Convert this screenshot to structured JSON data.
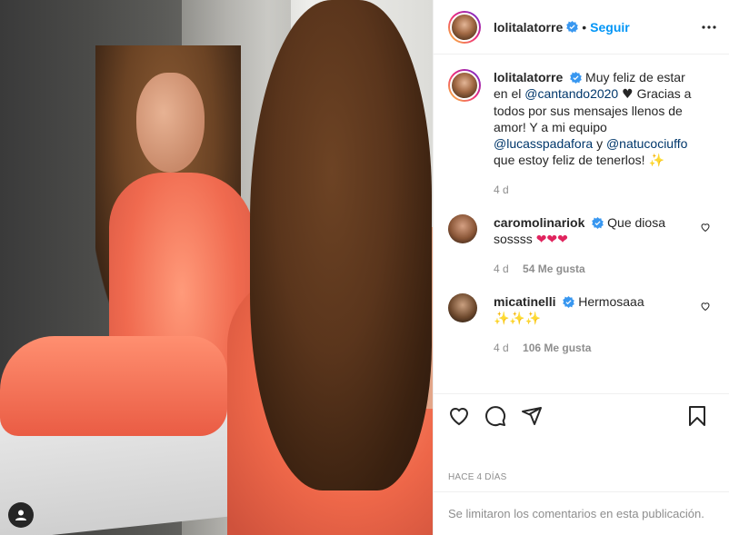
{
  "post": {
    "username": "lolitalatorre",
    "follow_label": "Seguir",
    "caption_parts": {
      "text1": "Muy feliz de estar en el",
      "mention1": "@cantando2020",
      "text2": "Gracias a todos por sus mensajes llenos de amor! Y a mi equipo",
      "mention2": "@lucasspadafora",
      "text3": "y",
      "mention3": "@natucociuffo",
      "text4": "que estoy feliz de tenerlos!"
    },
    "caption_time": "4 d",
    "time_ago": "HACE 4 DÍAS",
    "comments_limited": "Se limitaron los comentarios en esta publicación."
  },
  "comments": [
    {
      "user": "caromolinariok",
      "text": "Que diosa sossss",
      "time": "4 d",
      "likes": "54 Me gusta"
    },
    {
      "user": "micatinelli",
      "text": "Hermosaaa",
      "time": "4 d",
      "likes": "106 Me gusta"
    }
  ],
  "icons": {
    "verified": "verified-badge-icon",
    "more": "more-options-icon",
    "like": "heart-icon",
    "comment": "comment-icon",
    "share": "share-icon",
    "save": "bookmark-icon",
    "user_tag": "user-tag-icon"
  },
  "colors": {
    "accent": "#0095f6",
    "text": "#262626",
    "muted": "#8e8e8e",
    "mention": "#00376b"
  }
}
